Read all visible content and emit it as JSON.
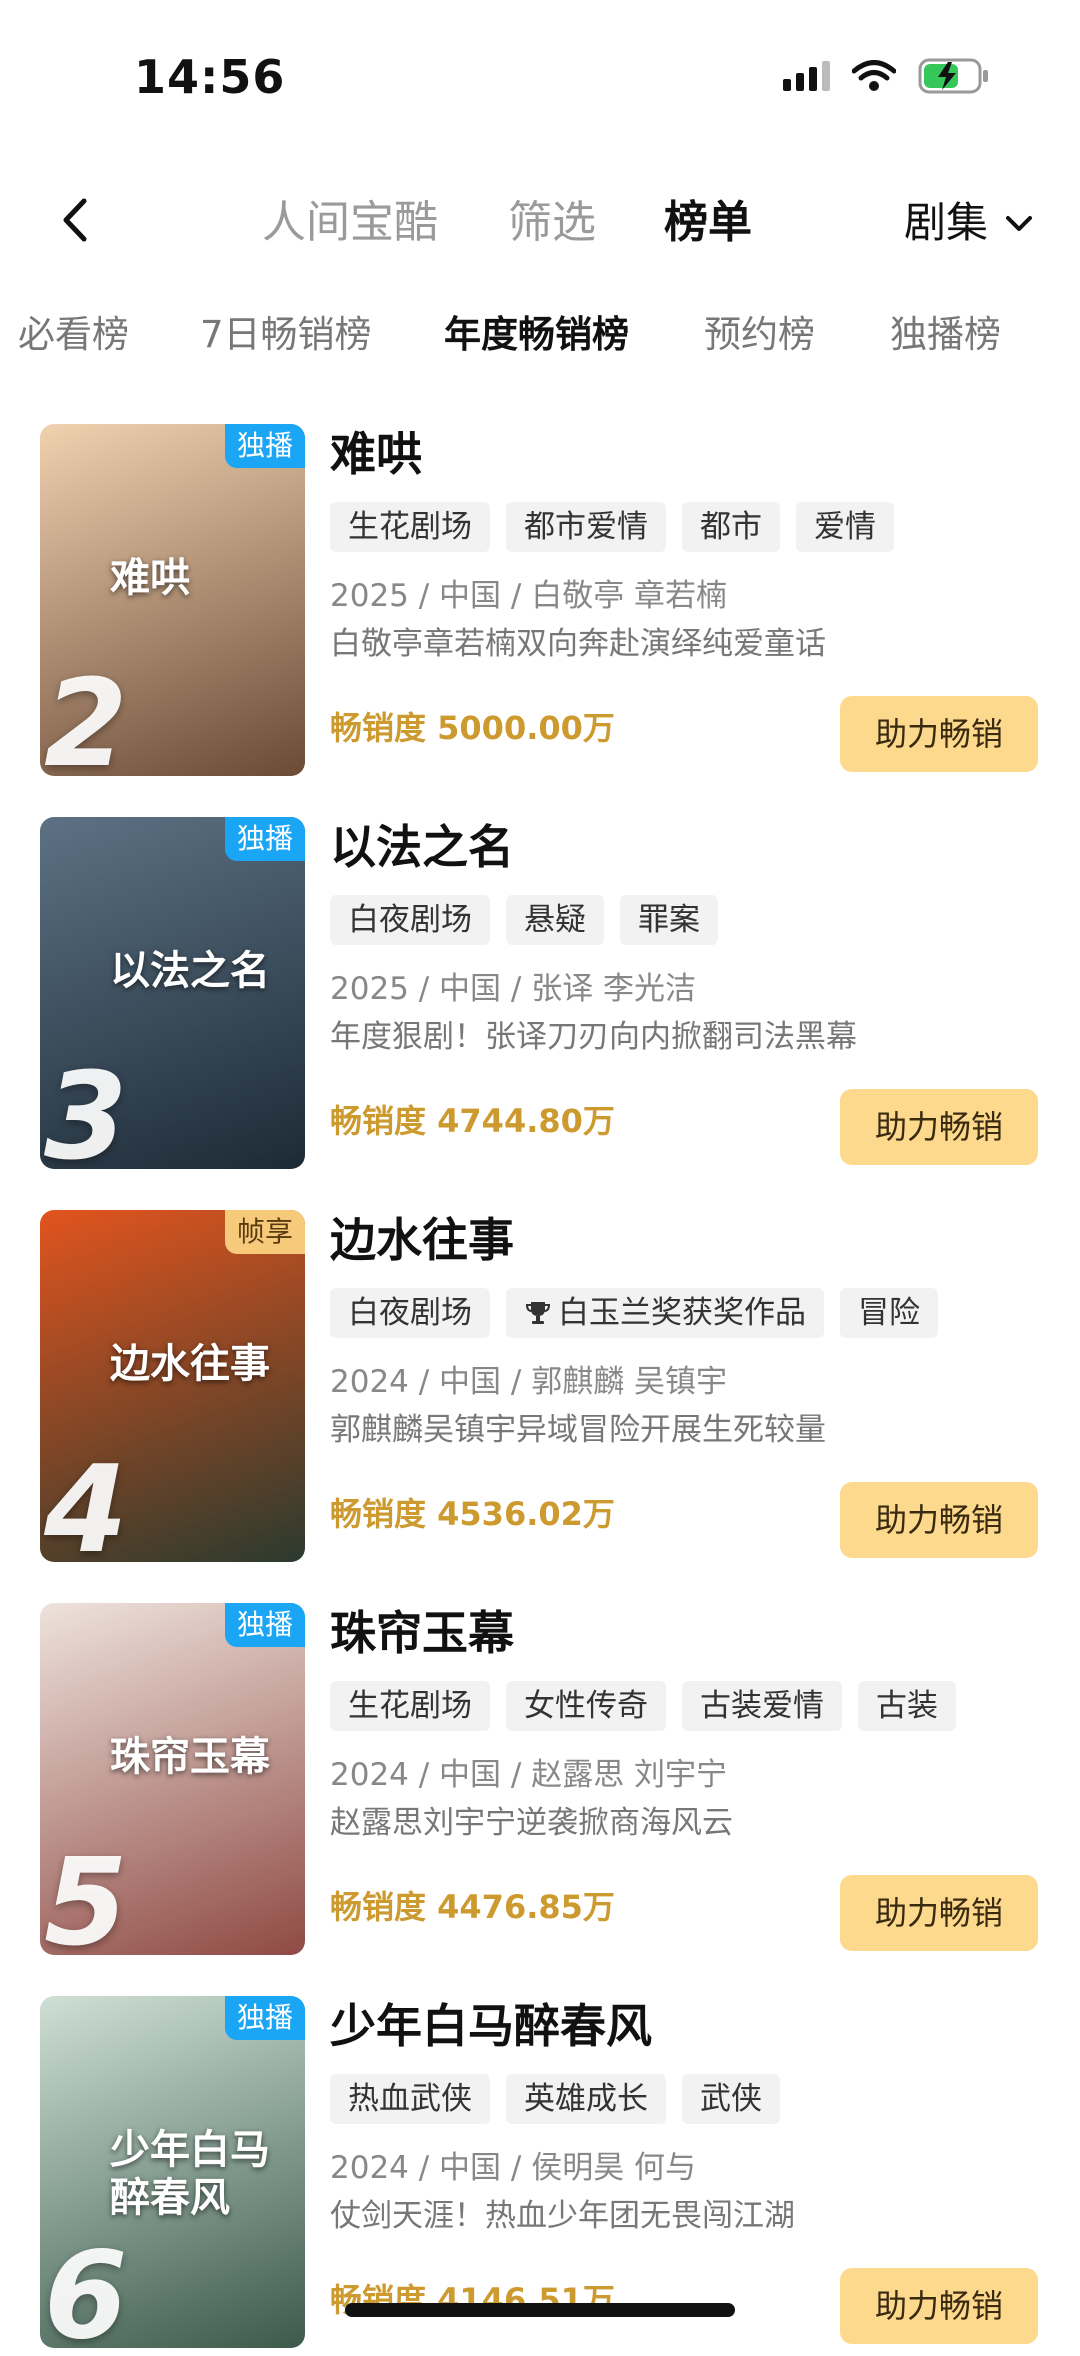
{
  "status_bar": {
    "time": "14:56"
  },
  "nav": {
    "tabs": [
      "人间宝酷",
      "筛选",
      "榜单"
    ],
    "active_tab": 2,
    "category": "剧集"
  },
  "chart_tabs": {
    "items": [
      "必看榜",
      "7日畅销榜",
      "年度畅销榜",
      "预约榜",
      "独播榜"
    ],
    "active": 2
  },
  "dramas": [
    {
      "rank": "2",
      "poster_text": "难哄",
      "badge": "独播",
      "badge_color": "#1aa6f5",
      "title": "难哄",
      "tags": [
        "生花剧场",
        "都市爱情",
        "都市",
        "爱情"
      ],
      "meta": "2025 / 中国 / 白敬亭 章若楠",
      "desc": "白敬亭章若楠双向奔赴演绎纯爱童话",
      "sales": "畅销度 5000.00万",
      "button": "助力畅销",
      "poster_colors": [
        "#f0d2b0",
        "#6b4a36"
      ]
    },
    {
      "rank": "3",
      "poster_text": "以法之名",
      "badge": "独播",
      "badge_color": "#1aa6f5",
      "title": "以法之名",
      "tags": [
        "白夜剧场",
        "悬疑",
        "罪案"
      ],
      "meta": "2025 / 中国 / 张译 李光洁",
      "desc": "年度狠剧！张译刀刃向内掀翻司法黑幕",
      "sales": "畅销度 4744.80万",
      "button": "助力畅销",
      "poster_colors": [
        "#5c7284",
        "#1d2a36"
      ]
    },
    {
      "rank": "4",
      "poster_text": "边水往事",
      "badge": "帧享",
      "badge_color": "#f6c97b",
      "title": "边水往事",
      "tags": [
        "白夜剧场",
        "白玉兰奖获奖作品",
        "冒险"
      ],
      "award_tag_index": 1,
      "meta": "2024 / 中国 / 郭麒麟 吴镇宇",
      "desc": "郭麒麟吴镇宇异域冒险开展生死较量",
      "sales": "畅销度 4536.02万",
      "button": "助力畅销",
      "poster_colors": [
        "#e2541e",
        "#2b3a2e"
      ]
    },
    {
      "rank": "5",
      "poster_text": "珠帘玉幕",
      "badge": "独播",
      "badge_color": "#1aa6f5",
      "title": "珠帘玉幕",
      "tags": [
        "生花剧场",
        "女性传奇",
        "古装爱情",
        "古装"
      ],
      "meta": "2024 / 中国 / 赵露思 刘宇宁",
      "desc": "赵露思刘宇宁逆袭掀商海风云",
      "sales": "畅销度 4476.85万",
      "button": "助力畅销",
      "poster_colors": [
        "#eee3dc",
        "#8f4a44"
      ]
    },
    {
      "rank": "6",
      "poster_text": "少年白马醉春风",
      "badge": "独播",
      "badge_color": "#1aa6f5",
      "title": "少年白马醉春风",
      "tags": [
        "热血武侠",
        "英雄成长",
        "武侠"
      ],
      "meta": "2024 / 中国 / 侯明昊 何与",
      "desc": "仗剑天涯！热血少年团无畏闯江湖",
      "sales": "畅销度 4146.51万",
      "button": "助力畅销",
      "poster_colors": [
        "#cfe0d6",
        "#3c5a4c"
      ]
    }
  ]
}
